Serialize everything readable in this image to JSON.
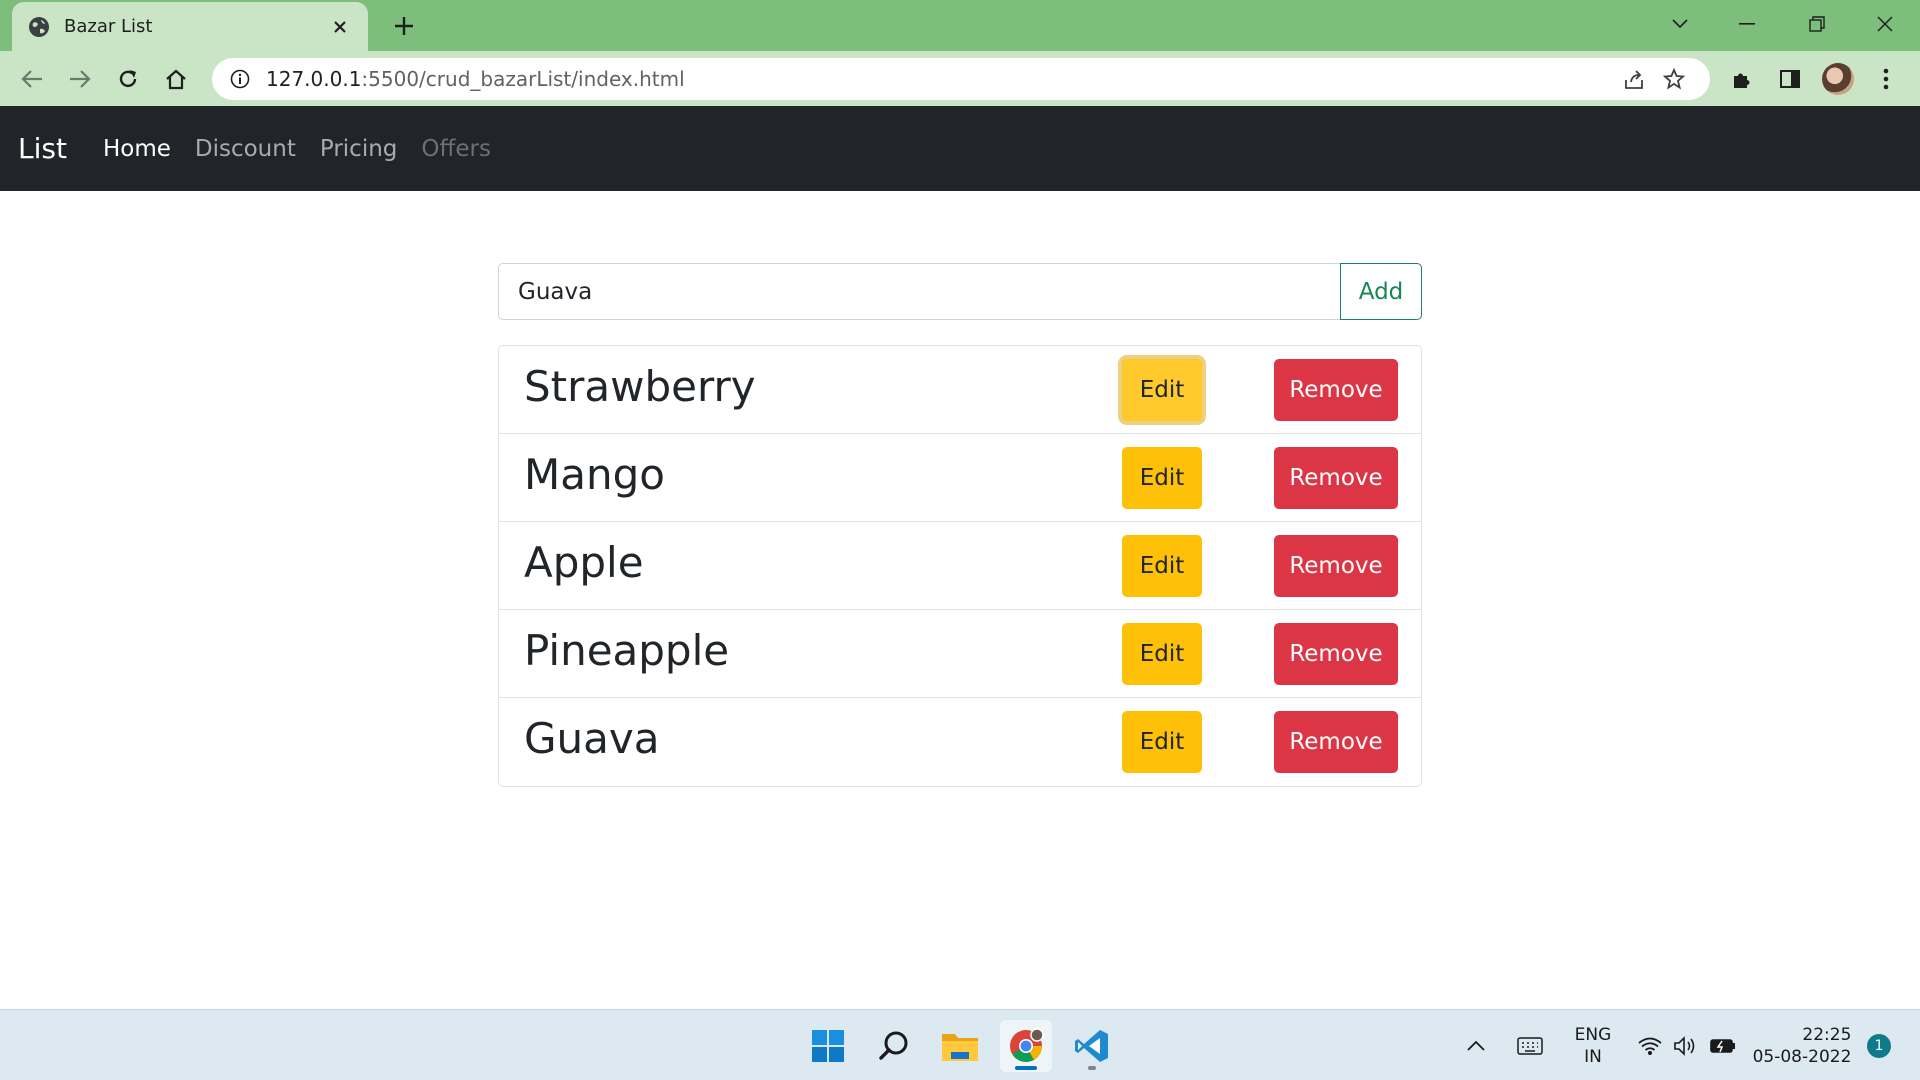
{
  "browser": {
    "tab_title": "Bazar List",
    "url_host": "127.0.0.1",
    "url_rest": ":5500/crud_bazarList/index.html"
  },
  "navbar": {
    "brand": "List",
    "links": [
      "Home",
      "Discount",
      "Pricing",
      "Offers"
    ]
  },
  "form": {
    "input_value": "Guava",
    "add_label": "Add"
  },
  "items": [
    {
      "name": "Strawberry",
      "edit": "Edit",
      "remove": "Remove"
    },
    {
      "name": "Mango",
      "edit": "Edit",
      "remove": "Remove"
    },
    {
      "name": "Apple",
      "edit": "Edit",
      "remove": "Remove"
    },
    {
      "name": "Pineapple",
      "edit": "Edit",
      "remove": "Remove"
    },
    {
      "name": "Guava",
      "edit": "Edit",
      "remove": "Remove"
    }
  ],
  "taskbar": {
    "language": "ENG",
    "region": "IN",
    "time": "22:25",
    "date": "05-08-2022",
    "notifications": "1"
  },
  "colors": {
    "navbar_bg": "#212529",
    "add_green": "#198754",
    "edit_yellow": "#ffc107",
    "remove_red": "#dc3545",
    "tab_strip": "#7dbe7c"
  }
}
